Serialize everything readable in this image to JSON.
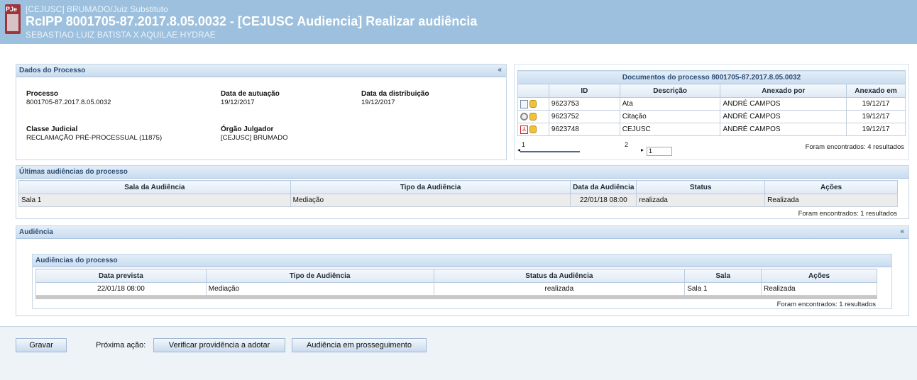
{
  "header": {
    "sub1": "[CEJUSC] BRUMADO/Juiz Substituto",
    "title": "RcIPP 8001705-87.2017.8.05.0032 - [CEJUSC Audiencia] Realizar audiência",
    "sub2": "SEBASTIAO LUIZ BATISTA X AQUILAE HYDRAE",
    "logo_text": "PJe"
  },
  "dados": {
    "title": "Dados do Processo",
    "collapse": "«",
    "processo_label": "Processo",
    "processo_value": "8001705-87.2017.8.05.0032",
    "autuacao_label": "Data de autuação",
    "autuacao_value": "19/12/2017",
    "distribuicao_label": "Data da distribuição",
    "distribuicao_value": "19/12/2017",
    "classe_label": "Classe Judicial",
    "classe_value": "RECLAMAÇÃO PRÉ-PROCESSUAL (11875)",
    "orgao_label": "Órgão Julgador",
    "orgao_value": "[CEJUSC] BRUMADO"
  },
  "documentos": {
    "title": "Documentos do processo 8001705-87.2017.8.05.0032",
    "columns": [
      "ID",
      "Descrição",
      "Anexado por",
      "Anexado em"
    ],
    "rows": [
      {
        "icon": "document-icon",
        "id": "9623753",
        "descricao": "Ata",
        "anexado_por": "ANDRÉ CAMPOS",
        "anexado_em": "19/12/17"
      },
      {
        "icon": "magnifier-icon",
        "id": "9623752",
        "descricao": "Citação",
        "anexado_por": "ANDRÉ CAMPOS",
        "anexado_em": "19/12/17"
      },
      {
        "icon": "pdf-icon",
        "id": "9623748",
        "descricao": "CEJUSC",
        "anexado_por": "ANDRÉ CAMPOS",
        "anexado_em": "19/12/17"
      }
    ],
    "page1": "1",
    "page2": "2",
    "page_input": "1",
    "found": "Foram encontrados: 4 resultados"
  },
  "ultimas": {
    "title": "Últimas audiências do processo",
    "columns": [
      "Sala da Audiência",
      "Tipo da Audiência",
      "Data da Audiência",
      "Status",
      "Ações"
    ],
    "rows": [
      {
        "sala": "Sala 1",
        "tipo": "Mediação",
        "data": "22/01/18 08:00",
        "status": "realizada",
        "acoes": "Realizada"
      }
    ],
    "found": "Foram encontrados: 1 resultados"
  },
  "audiencia": {
    "title": "Audiência",
    "collapse": "«",
    "inner_title": "Audiências do processo",
    "columns": [
      "Data prevista",
      "Tipo de Audiência",
      "Status da Audiência",
      "Sala",
      "Ações"
    ],
    "rows": [
      {
        "data": "22/01/18 08:00",
        "tipo": "Mediação",
        "status": "realizada",
        "sala": "Sala 1",
        "acoes": "Realizada"
      }
    ],
    "found": "Foram encontrados: 1 resultados"
  },
  "footer": {
    "gravar": "Gravar",
    "proxima_label": "Próxima ação:",
    "btn_verificar": "Verificar providência a adotar",
    "btn_prosseguimento": "Audiência em prosseguimento"
  },
  "colors": {
    "header_bg": "#9cc0dd",
    "panel_head": "#c9dcef",
    "logo": "#a0343c"
  }
}
